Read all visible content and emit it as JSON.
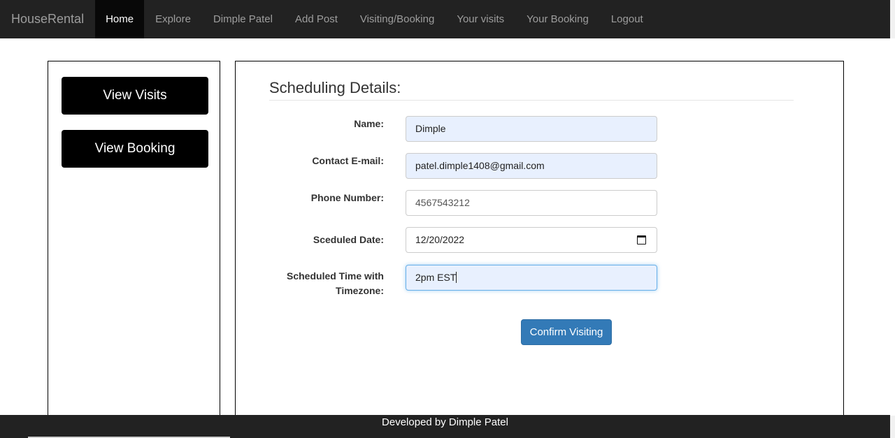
{
  "navbar": {
    "brand": "HouseRental",
    "items": [
      {
        "label": "Home",
        "active": true
      },
      {
        "label": "Explore"
      },
      {
        "label": "Dimple Patel"
      },
      {
        "label": "Add Post"
      },
      {
        "label": "Visiting/Booking"
      },
      {
        "label": "Your visits"
      },
      {
        "label": "Your Booking"
      },
      {
        "label": "Logout"
      }
    ]
  },
  "sidebar": {
    "view_visits": "View Visits",
    "view_booking": "View Booking"
  },
  "form": {
    "title": "Scheduling Details:",
    "name_label": "Name:",
    "name_value": "Dimple",
    "email_label": "Contact E-mail:",
    "email_value": "patel.dimple1408@gmail.com",
    "phone_label": "Phone Number:",
    "phone_value": "4567543212",
    "date_label": "Sceduled Date:",
    "date_value": "12/20/2022",
    "time_label_line1": "Scheduled Time with",
    "time_label_line2": "Timezone:",
    "time_value": "2pm EST",
    "confirm_button": "Confirm Visiting"
  },
  "footer": {
    "text": "Developed by Dimple Patel"
  },
  "colors": {
    "navbar_bg": "#222222",
    "primary_button": "#337ab7",
    "autofill_bg": "#e8f0fe"
  }
}
